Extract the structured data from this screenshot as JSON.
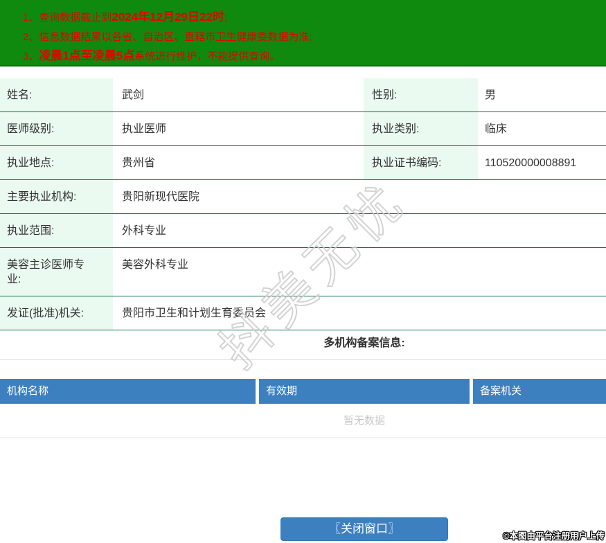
{
  "notice_banner": {
    "bg_color": "#0f8a0f",
    "text_color": "#e80000",
    "items": [
      {
        "prefix": "1、",
        "pre": "查询数据截止到",
        "bold": "2024年12月29日22时",
        "post": ";"
      },
      {
        "prefix": "2、",
        "pre": "信息数据结果以各省、自治区、直辖市卫生健康委数据为准;",
        "bold": "",
        "post": ""
      },
      {
        "prefix": "3、",
        "pre": "",
        "bold": "凌晨1点至凌晨5点",
        "post": "系统进行维护，不能提供查询。"
      }
    ]
  },
  "doctor_info": {
    "rows": [
      {
        "label1": "姓名:",
        "value1": "武剑",
        "label2": "性别:",
        "value2": "男"
      },
      {
        "label1": "医师级别:",
        "value1": "执业医师",
        "label2": "执业类别:",
        "value2": "临床"
      },
      {
        "label1": "执业地点:",
        "value1": "贵州省",
        "label2": "执业证书编码:",
        "value2": "110520000008891"
      },
      {
        "label1": "主要执业机构:",
        "value1": "贵阳新现代医院"
      },
      {
        "label1": "执业范围:",
        "value1": "外科专业"
      },
      {
        "label1": "美容主诊医师专业:",
        "value1": "美容外科专业"
      },
      {
        "label1": "发证(批准)机关:",
        "value1": "贵阳市卫生和计划生育委员会"
      }
    ],
    "label_bg": "#eafaf1",
    "row_border_color": "#0e6c45"
  },
  "filing_section": {
    "title": "多机构备案信息:",
    "table": {
      "headers": [
        "机构名称",
        "有效期",
        "备案机关"
      ],
      "header_bg": "#3d80c0",
      "empty_text": "暂无数据"
    }
  },
  "footer": {
    "close_button_label": "〖关闭窗口〗",
    "credit": "©本图由平台注册用户上传"
  },
  "watermark": {
    "text": "抖美无忧"
  }
}
